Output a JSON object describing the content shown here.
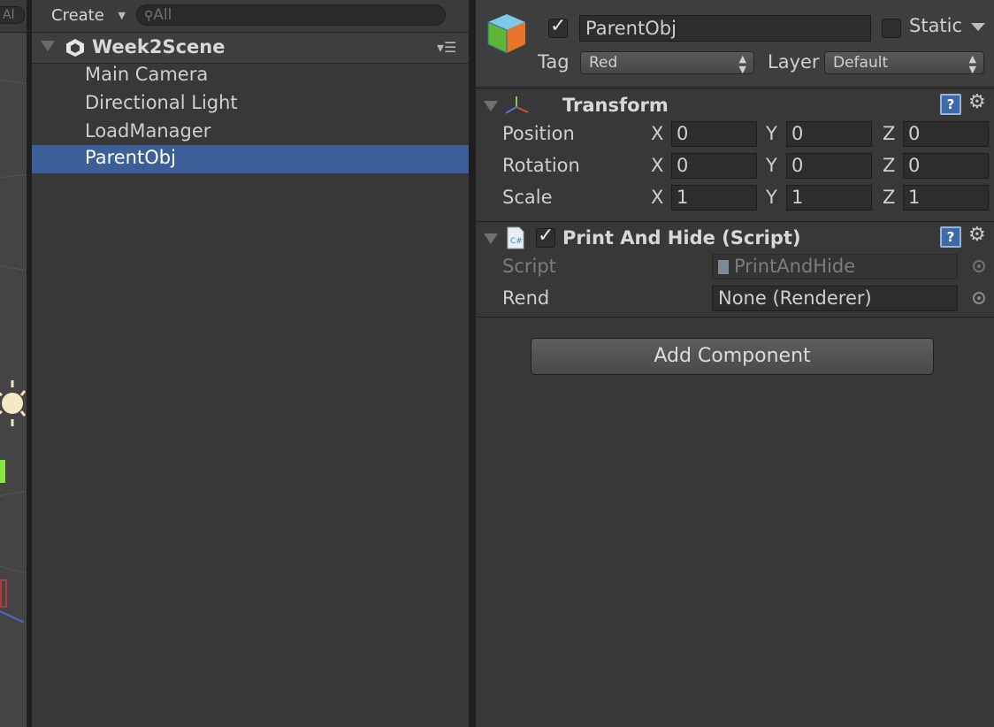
{
  "scene_view": {
    "search_fragment": "Al"
  },
  "hierarchy": {
    "create_label": "Create",
    "search_placeholder": "All",
    "scene_name": "Week2Scene",
    "items": [
      {
        "label": "Main Camera",
        "selected": false
      },
      {
        "label": "Directional Light",
        "selected": false
      },
      {
        "label": "LoadManager",
        "selected": false
      },
      {
        "label": "ParentObj",
        "selected": true
      }
    ]
  },
  "inspector": {
    "object_name": "ParentObj",
    "active": true,
    "static_label": "Static",
    "static_checked": false,
    "tag_label": "Tag",
    "tag_value": "Red",
    "layer_label": "Layer",
    "layer_value": "Default",
    "transform": {
      "title": "Transform",
      "rows": [
        {
          "label": "Position",
          "x": "0",
          "y": "0",
          "z": "0"
        },
        {
          "label": "Rotation",
          "x": "0",
          "y": "0",
          "z": "0"
        },
        {
          "label": "Scale",
          "x": "1",
          "y": "1",
          "z": "1"
        }
      ],
      "axis_x": "X",
      "axis_y": "Y",
      "axis_z": "Z"
    },
    "script_component": {
      "title": "Print And Hide (Script)",
      "enabled": true,
      "script_label": "Script",
      "script_value": "PrintAndHide",
      "rend_label": "Rend",
      "rend_value": "None (Renderer)"
    },
    "add_component_label": "Add Component"
  },
  "colors": {
    "panel_bg": "#383838",
    "selection": "#3d5f99",
    "help_blue": "#3d6aa8"
  },
  "icons": [
    "unity-logo-icon",
    "search-icon",
    "cube-icon",
    "transform-axes-icon",
    "csharp-script-icon",
    "help-icon",
    "gear-icon",
    "object-picker-icon",
    "menu-icon"
  ]
}
